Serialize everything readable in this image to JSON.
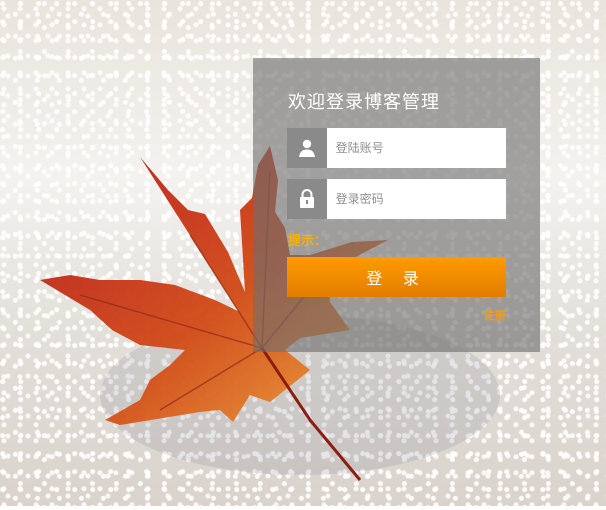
{
  "title": "欢迎登录博客管理",
  "username": {
    "placeholder": "登陆账号",
    "value": "",
    "icon": "user-icon"
  },
  "password": {
    "placeholder": "登录密码",
    "value": "",
    "icon": "lock-icon"
  },
  "tip": {
    "label": "提示：",
    "message": ""
  },
  "login_button": "登 录",
  "register_link": "注册",
  "colors": {
    "accent": "#f39000",
    "panel": "#6e6e6e"
  }
}
